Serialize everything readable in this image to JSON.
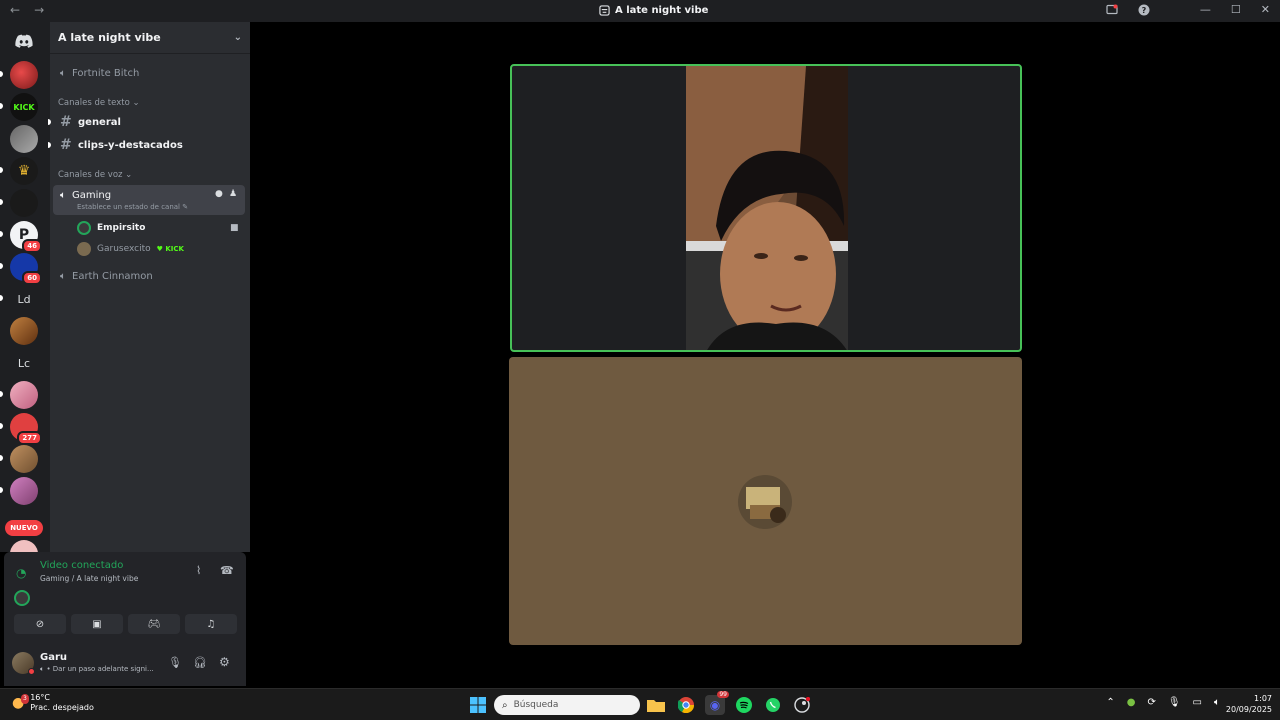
{
  "window": {
    "title": "A late night vibe"
  },
  "server": {
    "name": "A late night vibe",
    "channels": {
      "top_voice": "Fortnite Bitch",
      "text_category": "Canales de texto",
      "text_channels": [
        "general",
        "clips-y-destacados"
      ],
      "voice_category": "Canales de voz",
      "active_voice": "Gaming",
      "active_voice_status": "Establece un estado de canal",
      "voice_users": [
        {
          "name": "Empirsito"
        },
        {
          "name": "Garusexcito",
          "tag": "KICK"
        }
      ],
      "other_voice": "Earth Cinnamon"
    }
  },
  "guild_rail": {
    "badges": [
      "46",
      "60",
      "277"
    ],
    "letters": [
      "Ld",
      "Lc"
    ],
    "new_label": "NUEVO",
    "kick_label": "KICK"
  },
  "voice_panel": {
    "status": "Video conectado",
    "location": "Gaming / A late night vibe"
  },
  "user": {
    "name": "Garu",
    "status": "• Dar un paso adelante signi..."
  },
  "taskbar": {
    "weather_temp": "16°C",
    "weather_desc": "Prac. despejado",
    "weather_badge": "3",
    "search_placeholder": "Búsqueda",
    "time": "1:07",
    "date": "20/09/2025",
    "discord_badge": "99"
  },
  "colors": {
    "speaking_border": "#47c158",
    "connected_green": "#23a55a",
    "tile_bg": "#6f5a40"
  }
}
